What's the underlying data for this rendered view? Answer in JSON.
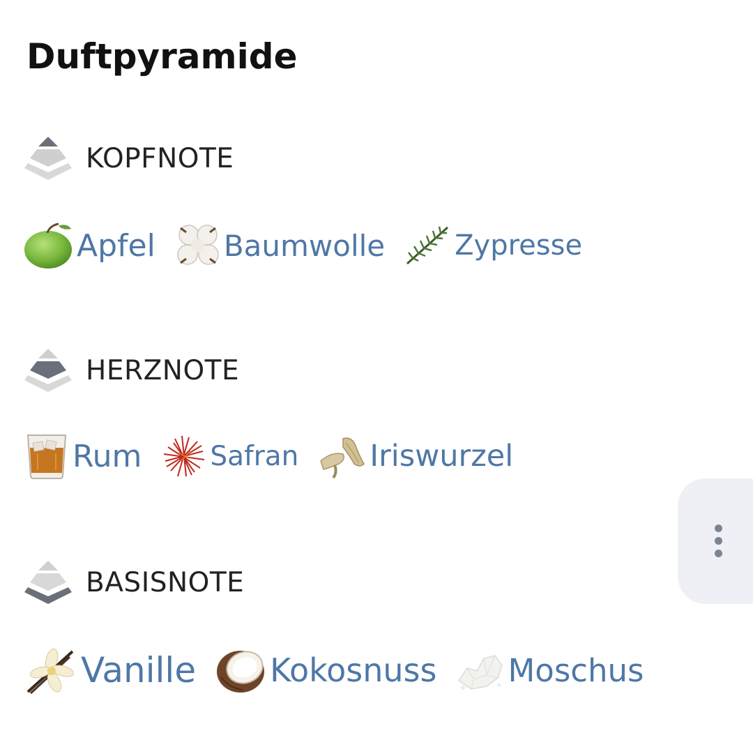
{
  "page": {
    "title": "Duftpyramide"
  },
  "sections": [
    {
      "label": "KOPFNOTE",
      "level": "top",
      "notes": [
        {
          "label": "Apfel",
          "icon": "green-apple-icon"
        },
        {
          "label": "Baumwolle",
          "icon": "cotton-flower-icon"
        },
        {
          "label": "Zypresse",
          "icon": "cypress-branch-icon"
        }
      ]
    },
    {
      "label": "HERZNOTE",
      "level": "middle",
      "notes": [
        {
          "label": "Rum",
          "icon": "rum-glass-icon"
        },
        {
          "label": "Safran",
          "icon": "saffron-threads-icon"
        },
        {
          "label": "Iriswurzel",
          "icon": "orris-root-icon"
        }
      ]
    },
    {
      "label": "BASISNOTE",
      "level": "base",
      "notes": [
        {
          "label": "Vanille",
          "icon": "vanilla-flower-icon"
        },
        {
          "label": "Kokosnuss",
          "icon": "coconut-icon"
        },
        {
          "label": "Moschus",
          "icon": "musk-crystals-icon"
        }
      ]
    }
  ],
  "colors": {
    "link": "#4e77a6",
    "pyramid_active": "#6b6f7a",
    "pyramid_inactive": "#cfcfcf",
    "fab_background": "#eef0f5"
  },
  "fab": {
    "icon": "more-vertical-icon"
  }
}
